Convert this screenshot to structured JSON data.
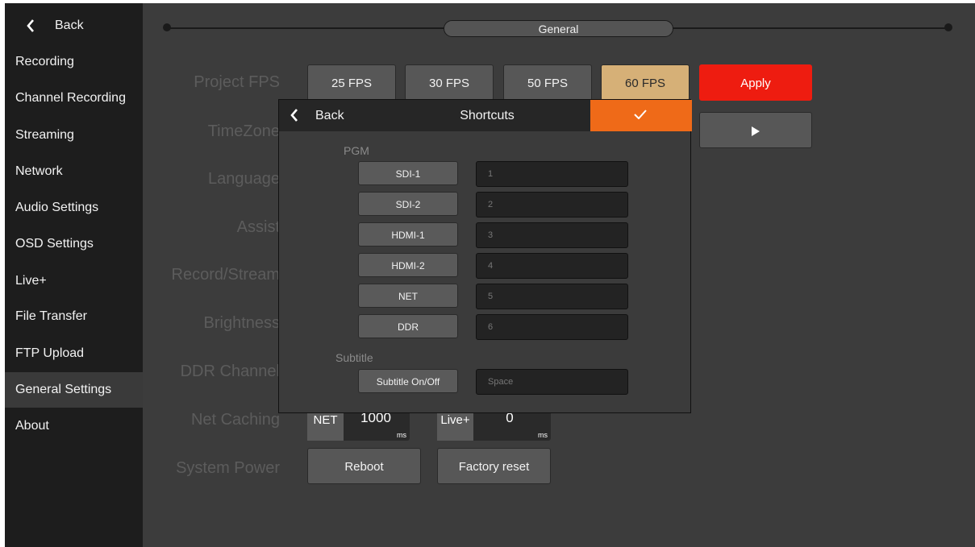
{
  "sidebar": {
    "back_label": "Back",
    "items": [
      {
        "label": "Recording"
      },
      {
        "label": "Channel Recording"
      },
      {
        "label": "Streaming"
      },
      {
        "label": "Network"
      },
      {
        "label": "Audio Settings"
      },
      {
        "label": "OSD Settings"
      },
      {
        "label": "Live+"
      },
      {
        "label": "File Transfer"
      },
      {
        "label": "FTP Upload"
      },
      {
        "label": "General Settings",
        "active": true
      },
      {
        "label": "About"
      }
    ]
  },
  "header": {
    "tab": "General"
  },
  "settings": {
    "project_fps_label": "Project FPS",
    "fps_options": [
      "25 FPS",
      "30 FPS",
      "50 FPS",
      "60 FPS"
    ],
    "fps_selected": "60 FPS",
    "apply_label": "Apply",
    "timezone_label": "TimeZone",
    "language_label": "Language",
    "assist_label": "Assist",
    "record_stream_label": "Record/Stream",
    "brightness_label": "Brightness",
    "ddr_channel_label": "DDR Channel",
    "net_caching_label": "Net Caching",
    "net_tag": "NET",
    "net_value": "1000",
    "net_unit": "ms",
    "live_tag": "Live+",
    "live_value": "0",
    "live_unit": "ms",
    "system_power_label": "System Power",
    "reboot_label": "Reboot",
    "factory_reset_label": "Factory reset"
  },
  "modal": {
    "back_label": "Back",
    "title": "Shortcuts",
    "pgm_label": "PGM",
    "shortcuts": [
      {
        "source": "SDI-1",
        "key": "1"
      },
      {
        "source": "SDI-2",
        "key": "2"
      },
      {
        "source": "HDMI-1",
        "key": "3"
      },
      {
        "source": "HDMI-2",
        "key": "4"
      },
      {
        "source": "NET",
        "key": "5"
      },
      {
        "source": "DDR",
        "key": "6"
      }
    ],
    "subtitle_label": "Subtitle",
    "subtitle_button": "Subtitle On/Off",
    "subtitle_key": "Space"
  },
  "colors": {
    "accent": "#ef6a18",
    "apply": "#ee1c10",
    "selected_fps": "#d6b077"
  }
}
